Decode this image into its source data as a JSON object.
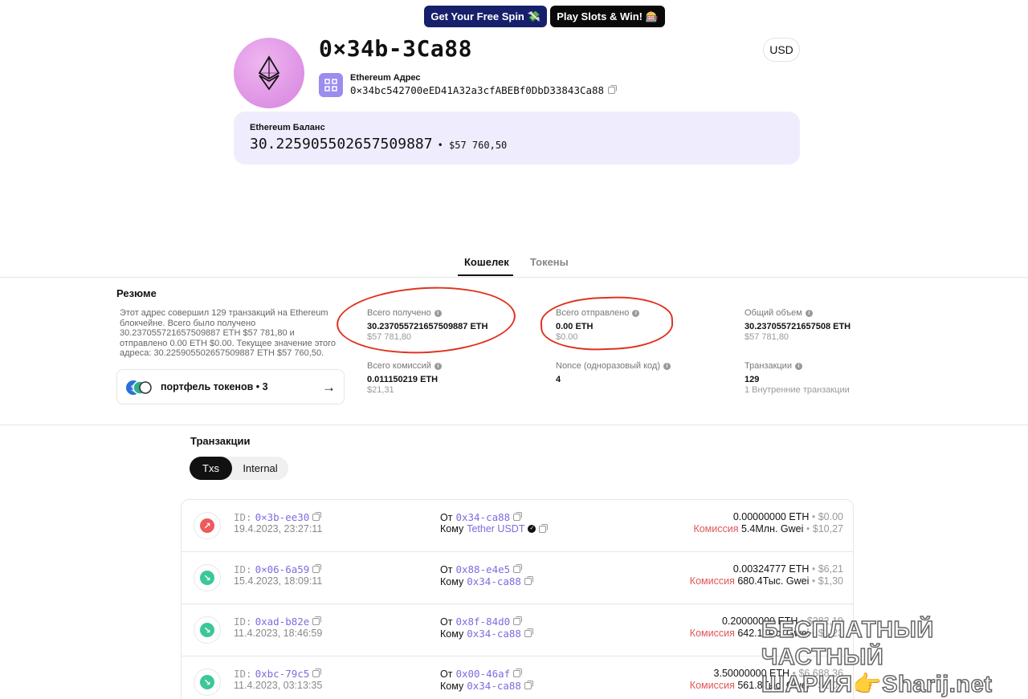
{
  "promo": {
    "spin_label": "Get Your Free Spin 💸",
    "slots_label": "Play Slots & Win! 🎰"
  },
  "header": {
    "title": "0×34b-3Ca88",
    "currency": "USD",
    "address_label": "Ethereum Адрес",
    "address_full": "0×34bc542700eED41A32a3cfABEBf0DbD33843Ca88"
  },
  "balance": {
    "label": "Ethereum Баланс",
    "eth": "30.225905502657509887",
    "usd": "• $57 760,50"
  },
  "tabs": {
    "wallet": "Кошелек",
    "tokens": "Токены"
  },
  "summary": {
    "title": "Резюме",
    "text": "Этот адрес совершил 129 транзакций на Ethereum блокчейне. Всего было получено 30.237055721657509887 ETH $57 781,80 и отправлено 0.00 ETH $0.00. Текущее значение этого адреса: 30.225905502657509887 ETH $57 760,50.",
    "token_portfolio": "портфель токенов • 3"
  },
  "stats": {
    "received": {
      "label": "Всего получено",
      "value": "30.237055721657509887 ETH",
      "sub": "$57 781,80"
    },
    "sent": {
      "label": "Всего отправлено",
      "value": "0.00 ETH",
      "sub": "$0.00"
    },
    "volume": {
      "label": "Общий объем",
      "value": "30.237055721657508 ETH",
      "sub": "$57 781,80"
    },
    "fees": {
      "label": "Всего комиссий",
      "value": "0.011150219 ETH",
      "sub": "$21,31"
    },
    "nonce": {
      "label": "Nonce (одноразовый код)",
      "value": "4",
      "sub": ""
    },
    "txs": {
      "label": "Транзакции",
      "value": "129",
      "sub": "1 Внутренние транзакции"
    }
  },
  "transactions": {
    "title": "Транзакции",
    "seg_txs": "Txs",
    "seg_internal": "Internal",
    "from_label": "От",
    "to_label": "Кому",
    "fee_label": "Комиссия",
    "rows": [
      {
        "direction": "out",
        "id_prefix": "ID:",
        "id": "0×3b-ee30",
        "date": "19.4.2023, 23:27:11",
        "from": "0x34-ca88",
        "to": "Tether USDT",
        "amount": "0.00000000 ETH",
        "amount_usd": "$0.00",
        "fee": "5.4Млн. Gwei",
        "fee_usd": "$10,27"
      },
      {
        "direction": "in",
        "id_prefix": "ID:",
        "id": "0×06-6a59",
        "date": "15.4.2023, 18:09:11",
        "from": "0x88-e4e5",
        "to": "0x34-ca88",
        "amount": "0.00324777 ETH",
        "amount_usd": "$6,21",
        "fee": "680.4Тыс. Gwei",
        "fee_usd": "$1,30"
      },
      {
        "direction": "in",
        "id_prefix": "ID:",
        "id": "0xad-b82e",
        "date": "11.4.2023, 18:46:59",
        "from": "0x8f-84d0",
        "to": "0x34-ca88",
        "amount": "0.20000000 ETH",
        "amount_usd": "$382,19",
        "fee": "642.1Тыс. Gwei",
        "fee_usd": "$1,23"
      },
      {
        "direction": "in",
        "id_prefix": "ID:",
        "id": "0xbc-79c5",
        "date": "11.4.2023, 03:13:35",
        "from": "0x00-46af",
        "to": "0x34-ca88",
        "amount": "3.50000000 ETH",
        "amount_usd": "$6 688,36",
        "fee": "561.8Тыс. Gwei",
        "fee_usd": "$1,07"
      }
    ]
  },
  "watermark": {
    "line1": "БЕСПЛАТНЫЙ ЧАСТНЫЙ",
    "line2": "ШАРИЯ👉Sharij.net"
  },
  "colors": {
    "accent": "#7b6de0",
    "out_icon": "#ef5a5a",
    "in_icon": "#3cc79a",
    "annotation": "#e0321e"
  }
}
